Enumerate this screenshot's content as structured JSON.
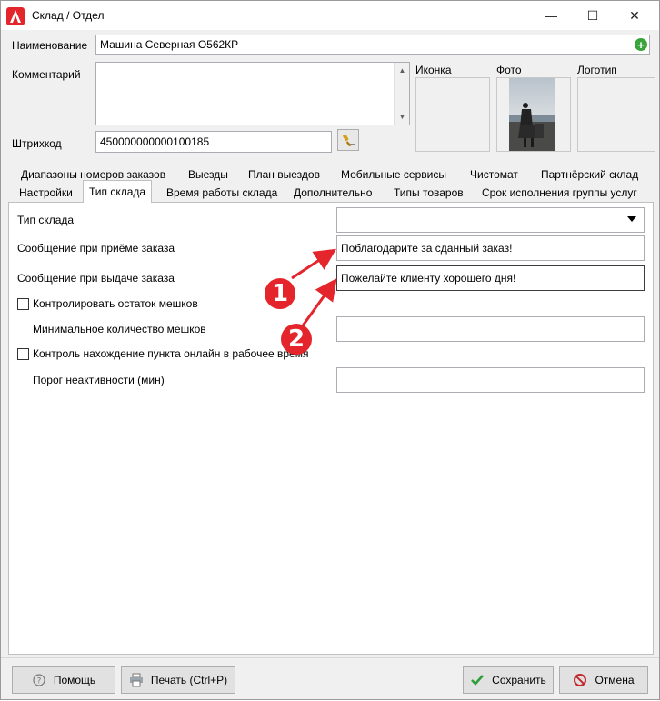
{
  "window": {
    "title": "Склад / Отдел",
    "controls": {
      "minimize": "—",
      "maximize": "☐",
      "close": "✕"
    }
  },
  "form": {
    "name_label": "Наименование",
    "name_value": "Машина Северная О562КР",
    "comment_label": "Комментарий",
    "comment_value": "",
    "barcode_label": "Штрихкод",
    "barcode_value": "450000000000100185",
    "icon_label": "Иконка",
    "photo_label": "Фото",
    "logo_label": "Логотип"
  },
  "tabs_row1": [
    {
      "label": "Диапазоны номеров заказов"
    },
    {
      "label": "Выезды"
    },
    {
      "label": "План выездов"
    },
    {
      "label": "Мобильные сервисы"
    },
    {
      "label": "Чистомат"
    },
    {
      "label": "Партнёрский склад"
    }
  ],
  "tabs_row2": [
    {
      "label": "Настройки"
    },
    {
      "label": "Тип склада",
      "selected": true
    },
    {
      "label": "Время работы склада"
    },
    {
      "label": "Дополнительно"
    },
    {
      "label": "Типы товаров"
    },
    {
      "label": "Срок исполнения группы услуг"
    }
  ],
  "panel": {
    "warehouse_type_label": "Тип склада",
    "warehouse_type_value": "",
    "receive_msg_label": "Сообщение при приёме заказа",
    "receive_msg_value": "Поблагодарите за сданный заказ!",
    "issue_msg_label": "Сообщение при выдаче заказа",
    "issue_msg_value": "Пожелайте клиенту хорошего дня!",
    "bags_control_label": "Контролировать остаток мешков",
    "bags_control_checked": false,
    "min_bags_label": "Минимальное количество мешков",
    "min_bags_value": "",
    "online_control_label": "Контроль нахождение пункта онлайн в рабочее время",
    "online_control_checked": false,
    "inactivity_label": "Порог неактивности (мин)",
    "inactivity_value": ""
  },
  "buttons": {
    "help": "Помощь",
    "print": "Печать (Ctrl+P)",
    "save": "Сохранить",
    "cancel": "Отмена"
  },
  "annotations": {
    "marker1": "1",
    "marker2": "2"
  },
  "colors": {
    "accent_red": "#e4252b",
    "save_green": "#2e9e3a"
  }
}
